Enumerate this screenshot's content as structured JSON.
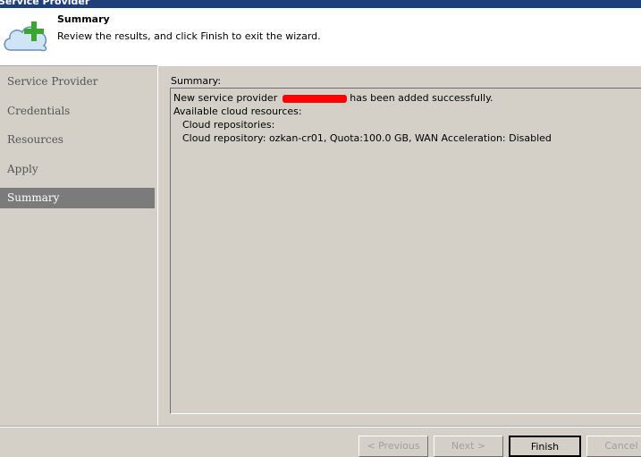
{
  "window": {
    "title": "Service Provider"
  },
  "header": {
    "title": "Summary",
    "subtitle": "Review the results, and click Finish to exit the wizard.",
    "icon": "cloud-add-icon"
  },
  "sidebar": {
    "items": [
      {
        "label": "Service Provider"
      },
      {
        "label": "Credentials"
      },
      {
        "label": "Resources"
      },
      {
        "label": "Apply"
      },
      {
        "label": "Summary",
        "selected": true
      }
    ]
  },
  "summary": {
    "label": "Summary:",
    "line1_prefix": "New service provider",
    "line1_suffix": "has been added successfully.",
    "line2": "Available cloud resources:",
    "line3": "Cloud repositories:",
    "line4": "Cloud repository: ozkan-cr01, Quota:100.0 GB, WAN Acceleration: Disabled"
  },
  "buttons": {
    "previous": "< Previous",
    "next": "Next >",
    "finish": "Finish",
    "cancel": "Cancel"
  },
  "colors": {
    "title_bar": "#1e3f7a",
    "selected_nav": "#7b7b7b",
    "redaction": "#ff0000",
    "icon_plus": "#3aa62f"
  }
}
